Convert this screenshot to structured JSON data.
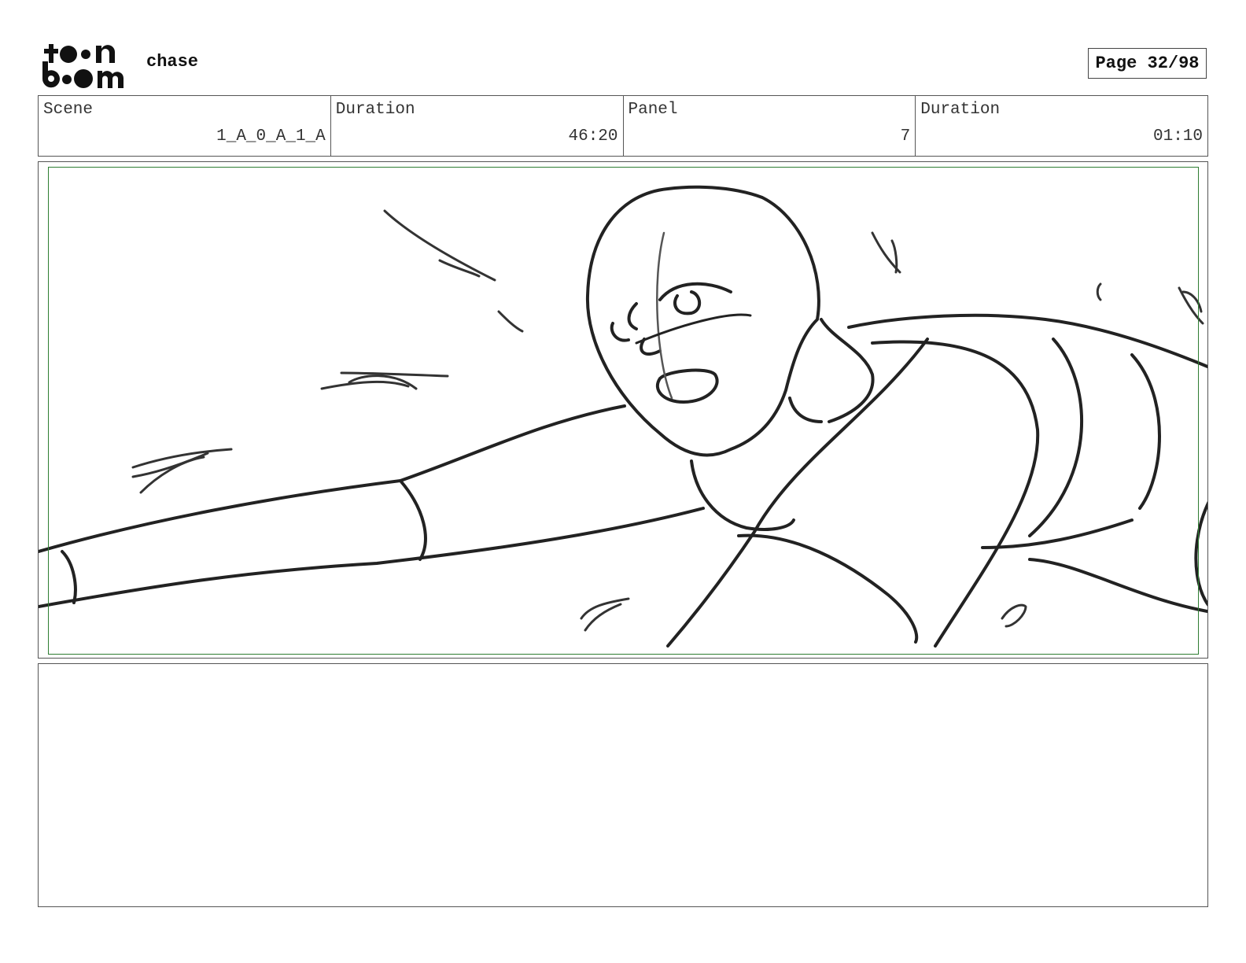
{
  "header": {
    "logo_text": "toon boom",
    "project_title": "chase",
    "page_indicator": "Page 32/98"
  },
  "info": {
    "scene_label": "Scene",
    "scene_value": "1_A_0_A_1_A",
    "scene_duration_label": "Duration",
    "scene_duration_value": "46:20",
    "panel_label": "Panel",
    "panel_value": "7",
    "panel_duration_label": "Duration",
    "panel_duration_value": "01:10"
  },
  "notes": {
    "text": ""
  },
  "colors": {
    "safe_area": "#2e7d32",
    "sketch_line": "#222222"
  }
}
